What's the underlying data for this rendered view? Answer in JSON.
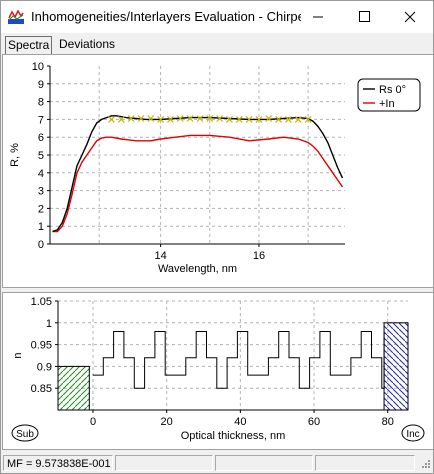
{
  "window": {
    "title": "Inhomogeneities/Interlayers Evaluation - Chirpe...",
    "minimize_glyph": "—",
    "maximize_glyph": "☐",
    "close_glyph": "✕"
  },
  "tabs": [
    {
      "label": "Spectra",
      "active": true
    },
    {
      "label": "Deviations",
      "active": false
    }
  ],
  "chart_data": [
    {
      "type": "line",
      "xlabel": "Wavelength, nm",
      "ylabel": "R, %",
      "xlim": [
        11.75,
        17.75
      ],
      "ylim": [
        0,
        10
      ],
      "xticks": [
        14,
        16
      ],
      "yticks": [
        0,
        1,
        2,
        3,
        4,
        5,
        6,
        7,
        8,
        9,
        10
      ],
      "grid": true,
      "legend_position": "top-right",
      "series": [
        {
          "name": "Rs 0°",
          "color": "#000000",
          "x": [
            11.8,
            11.9,
            12.0,
            12.1,
            12.2,
            12.3,
            12.4,
            12.5,
            12.6,
            12.7,
            12.8,
            12.9,
            13.0,
            13.1,
            13.2,
            13.3,
            13.5,
            13.7,
            14.0,
            14.3,
            14.6,
            15.0,
            15.4,
            15.8,
            16.2,
            16.5,
            16.8,
            17.0,
            17.1,
            17.2,
            17.3,
            17.4,
            17.5,
            17.6,
            17.7
          ],
          "y": [
            0.7,
            0.8,
            1.2,
            2.0,
            3.2,
            4.4,
            5.0,
            5.6,
            6.3,
            6.8,
            7.0,
            7.1,
            7.2,
            7.2,
            7.15,
            7.1,
            7.05,
            7.0,
            7.0,
            7.05,
            7.1,
            7.1,
            7.05,
            7.0,
            7.0,
            7.05,
            7.1,
            7.05,
            6.9,
            6.6,
            6.2,
            5.7,
            5.0,
            4.3,
            3.7
          ]
        },
        {
          "name": "+In",
          "color": "#e00000",
          "x": [
            11.8,
            11.9,
            12.0,
            12.1,
            12.2,
            12.3,
            12.4,
            12.5,
            12.6,
            12.7,
            12.8,
            12.9,
            13.0,
            13.2,
            13.5,
            13.8,
            14.0,
            14.3,
            14.6,
            15.0,
            15.4,
            15.8,
            16.2,
            16.5,
            16.8,
            17.0,
            17.1,
            17.2,
            17.3,
            17.4,
            17.5,
            17.6,
            17.7
          ],
          "y": [
            0.7,
            0.7,
            1.0,
            1.7,
            2.8,
            4.0,
            4.6,
            5.0,
            5.4,
            5.8,
            5.95,
            6.0,
            6.0,
            5.9,
            5.8,
            5.8,
            5.9,
            6.0,
            6.1,
            6.1,
            6.0,
            5.8,
            5.9,
            6.0,
            5.9,
            5.7,
            5.5,
            5.2,
            4.8,
            4.4,
            4.0,
            3.6,
            3.2
          ]
        },
        {
          "name": "markers",
          "marker": "x",
          "color": "#c8b400",
          "x": [
            13.0,
            13.2,
            13.4,
            13.6,
            13.8,
            14.0,
            14.2,
            14.4,
            14.6,
            14.8,
            15.0,
            15.2,
            15.4,
            15.6,
            15.8,
            16.0,
            16.2,
            16.4,
            16.6,
            16.8,
            17.0
          ],
          "y": [
            7.0,
            7.0,
            7.05,
            7.05,
            7.05,
            7.0,
            7.0,
            7.05,
            7.05,
            7.05,
            7.05,
            7.05,
            7.0,
            7.0,
            7.0,
            7.0,
            7.05,
            7.0,
            7.0,
            7.0,
            7.0
          ]
        }
      ]
    },
    {
      "type": "step",
      "xlabel": "Optical thickness, nm",
      "ylabel": "n",
      "xlim": [
        -9.5,
        85.5
      ],
      "ylim": [
        0.8,
        1.05
      ],
      "xticks": [
        0,
        20,
        40,
        60,
        80
      ],
      "yticks": [
        0.85,
        0.9,
        0.95,
        1,
        1.05
      ],
      "ytick_labels": [
        "0.85",
        "0.9",
        "0.95",
        "1",
        "1.05"
      ],
      "grid": true,
      "substrate": {
        "label": "Sub",
        "n": 0.9,
        "from": -9.5,
        "to": -1
      },
      "incident": {
        "label": "Inc",
        "n": 1.0,
        "from": 79,
        "to": 85.5
      },
      "profile_levels": [
        0.85,
        0.88,
        0.92,
        0.98
      ],
      "profile_period": 5.6,
      "profile_start": 0,
      "profile_end": 79
    }
  ],
  "statusbar": {
    "mf_text": "MF = 9.573838E-001"
  }
}
